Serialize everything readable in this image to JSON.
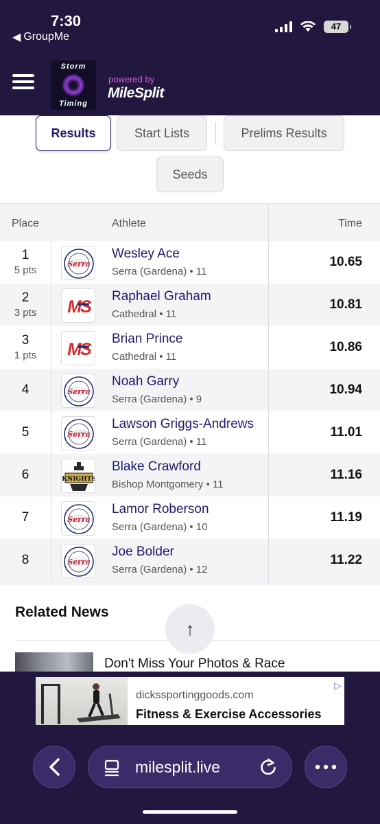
{
  "status_bar": {
    "time": "7:30",
    "back_app": "GroupMe",
    "battery": "47"
  },
  "header": {
    "logo_top": "Storm",
    "logo_bottom": "Timing",
    "powered_by": "powered by",
    "brand": "MileSplit"
  },
  "tabs": [
    {
      "label": "Results",
      "active": true
    },
    {
      "label": "Start Lists",
      "active": false
    },
    {
      "label": "Prelims Results",
      "active": false
    },
    {
      "label": "Seeds",
      "active": false
    }
  ],
  "table": {
    "headers": {
      "place": "Place",
      "athlete": "Athlete",
      "time": "Time"
    },
    "rows": [
      {
        "place": "1",
        "pts": "5 pts",
        "name": "Wesley Ace",
        "school": "Serra (Gardena) • 11",
        "time": "10.65",
        "logo": "serra"
      },
      {
        "place": "2",
        "pts": "3 pts",
        "name": "Raphael Graham",
        "school": "Cathedral • 11",
        "time": "10.81",
        "logo": "ms"
      },
      {
        "place": "3",
        "pts": "1 pts",
        "name": "Brian Prince",
        "school": "Cathedral • 11",
        "time": "10.86",
        "logo": "ms"
      },
      {
        "place": "4",
        "pts": "",
        "name": "Noah Garry",
        "school": "Serra (Gardena) • 9",
        "time": "10.94",
        "logo": "serra"
      },
      {
        "place": "5",
        "pts": "",
        "name": "Lawson Griggs-Andrews",
        "school": "Serra (Gardena) • 11",
        "time": "11.01",
        "logo": "serra"
      },
      {
        "place": "6",
        "pts": "",
        "name": "Blake Crawford",
        "school": "Bishop Montgomery • 11",
        "time": "11.16",
        "logo": "knights"
      },
      {
        "place": "7",
        "pts": "",
        "name": "Lamor Roberson",
        "school": "Serra (Gardena) • 10",
        "time": "11.19",
        "logo": "serra"
      },
      {
        "place": "8",
        "pts": "",
        "name": "Joe Bolder",
        "school": "Serra (Gardena) • 12",
        "time": "11.22",
        "logo": "serra"
      }
    ]
  },
  "logos": {
    "serra_text": "Serra",
    "ms_text": "MS",
    "knights_text": "KNIGHTS"
  },
  "related": {
    "title": "Related News",
    "news_title": "Don't Miss Your Photos & Race"
  },
  "ad": {
    "domain": "dickssportinggoods.com",
    "title": "Fitness & Exercise Accessories"
  },
  "browser": {
    "url": "milesplit.live"
  },
  "colors": {
    "header_bg": "#22183f",
    "accent": "#1f1a6e",
    "brand_pink": "#d65ed8"
  }
}
